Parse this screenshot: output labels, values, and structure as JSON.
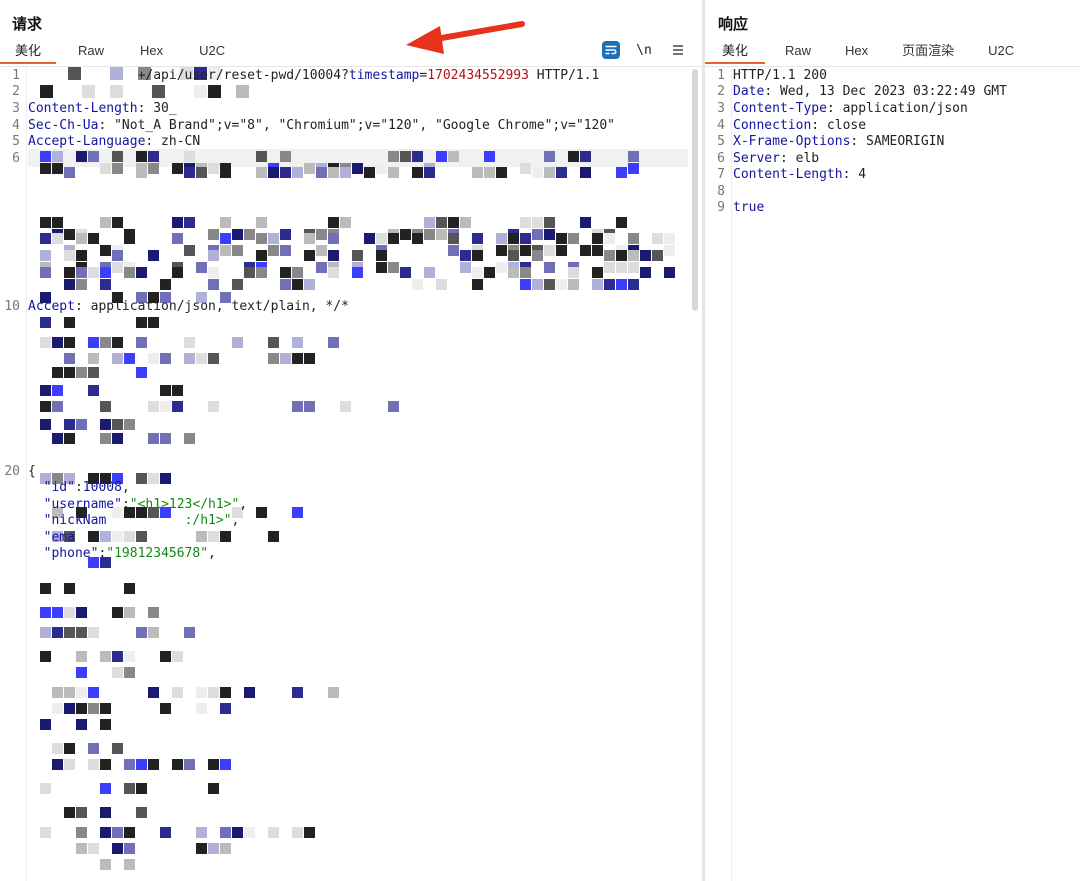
{
  "request": {
    "title": "请求",
    "tabs": [
      "美化",
      "Raw",
      "Hex",
      "U2C"
    ],
    "active_tab": "美化",
    "toolbar": {
      "wrap_icon": "wrap-lines-icon",
      "newline_label": "\\n",
      "menu_icon": "menu-icon"
    },
    "lines": [
      {
        "no": "1",
        "parts": [
          {
            "c": "plain",
            "t": "              +/api/user/reset-pwd/10004?"
          },
          {
            "c": "hk",
            "t": "timestamp"
          },
          {
            "c": "plain",
            "t": "="
          },
          {
            "c": "r",
            "t": "1702434552993"
          },
          {
            "c": "plain",
            "t": " HTTP/1.1"
          }
        ]
      },
      {
        "no": "2",
        "parts": []
      },
      {
        "no": "3",
        "parts": [
          {
            "c": "hk",
            "t": "Content-Length"
          },
          {
            "c": "plain",
            "t": ": 30_"
          }
        ]
      },
      {
        "no": "4",
        "parts": [
          {
            "c": "hk",
            "t": "Sec-Ch-Ua"
          },
          {
            "c": "plain",
            "t": ": \"Not_A Brand\";v=\"8\", \"Chromium\";v=\"120\", \"Google Chrome\";v=\"120\""
          }
        ]
      },
      {
        "no": "5",
        "parts": [
          {
            "c": "hk",
            "t": "Accept-Language"
          },
          {
            "c": "plain",
            "t": ": zh-CN"
          }
        ]
      },
      {
        "no": "6",
        "parts": []
      },
      {
        "no": "10",
        "parts": [
          {
            "c": "hk",
            "t": "Accept"
          },
          {
            "c": "plain",
            "t": ": application/json, text/plain, */*"
          }
        ]
      },
      {
        "no": "20",
        "parts": [
          {
            "c": "plain",
            "t": "{"
          }
        ]
      },
      {
        "no": "",
        "parts": [
          {
            "c": "plain",
            "t": "  "
          },
          {
            "c": "q",
            "t": "\"id\""
          },
          {
            "c": "plain",
            "t": ":"
          },
          {
            "c": "n",
            "t": "10008"
          },
          {
            "c": "plain",
            "t": ","
          }
        ]
      },
      {
        "no": "",
        "parts": [
          {
            "c": "plain",
            "t": "  "
          },
          {
            "c": "q",
            "t": "\"username\""
          },
          {
            "c": "plain",
            "t": ":"
          },
          {
            "c": "s",
            "t": "\"<h1>123</h1>\""
          },
          {
            "c": "plain",
            "t": ","
          }
        ]
      },
      {
        "no": "",
        "parts": [
          {
            "c": "plain",
            "t": "  "
          },
          {
            "c": "q",
            "t": "\"nickNam"
          },
          {
            "c": "plain",
            "t": "          "
          },
          {
            "c": "s",
            "t": ":/h1>\""
          },
          {
            "c": "plain",
            "t": ","
          }
        ]
      },
      {
        "no": "",
        "parts": [
          {
            "c": "plain",
            "t": "  "
          },
          {
            "c": "q",
            "t": "\"ema"
          }
        ]
      },
      {
        "no": "",
        "parts": [
          {
            "c": "plain",
            "t": "  "
          },
          {
            "c": "q",
            "t": "\"phone\""
          },
          {
            "c": "plain",
            "t": ":"
          },
          {
            "c": "s",
            "t": "\"19812345678\""
          },
          {
            "c": "plain",
            "t": ","
          }
        ]
      }
    ]
  },
  "response": {
    "title": "响应",
    "tabs": [
      "美化",
      "Raw",
      "Hex",
      "页面渲染",
      "U2C"
    ],
    "active_tab": "美化",
    "lines": [
      {
        "no": "1",
        "parts": [
          {
            "c": "plain",
            "t": "HTTP/1.1 200"
          }
        ]
      },
      {
        "no": "2",
        "parts": [
          {
            "c": "hk",
            "t": "Date"
          },
          {
            "c": "plain",
            "t": ": Wed, 13 Dec 2023 03:22:49 GMT"
          }
        ]
      },
      {
        "no": "3",
        "parts": [
          {
            "c": "hk",
            "t": "Content-Type"
          },
          {
            "c": "plain",
            "t": ": application/json"
          }
        ]
      },
      {
        "no": "4",
        "parts": [
          {
            "c": "hk",
            "t": "Connection"
          },
          {
            "c": "plain",
            "t": ": close"
          }
        ]
      },
      {
        "no": "5",
        "parts": [
          {
            "c": "hk",
            "t": "X-Frame-Options"
          },
          {
            "c": "plain",
            "t": ": SAMEORIGIN"
          }
        ]
      },
      {
        "no": "6",
        "parts": [
          {
            "c": "hk",
            "t": "Server"
          },
          {
            "c": "plain",
            "t": ": elb"
          }
        ]
      },
      {
        "no": "7",
        "parts": [
          {
            "c": "hk",
            "t": "Content-Length"
          },
          {
            "c": "plain",
            "t": ": 4"
          }
        ]
      },
      {
        "no": "8",
        "parts": []
      },
      {
        "no": "9",
        "parts": [
          {
            "c": "hk",
            "t": "true"
          }
        ]
      }
    ]
  },
  "colors": {
    "accent_tab_underline": "#e8622c",
    "header_key": "#1414a0",
    "string_value": "#138a13",
    "timestamp_value": "#b01414",
    "annotation_arrow": "#e8321c",
    "wrap_button": "#1d6fb8"
  }
}
